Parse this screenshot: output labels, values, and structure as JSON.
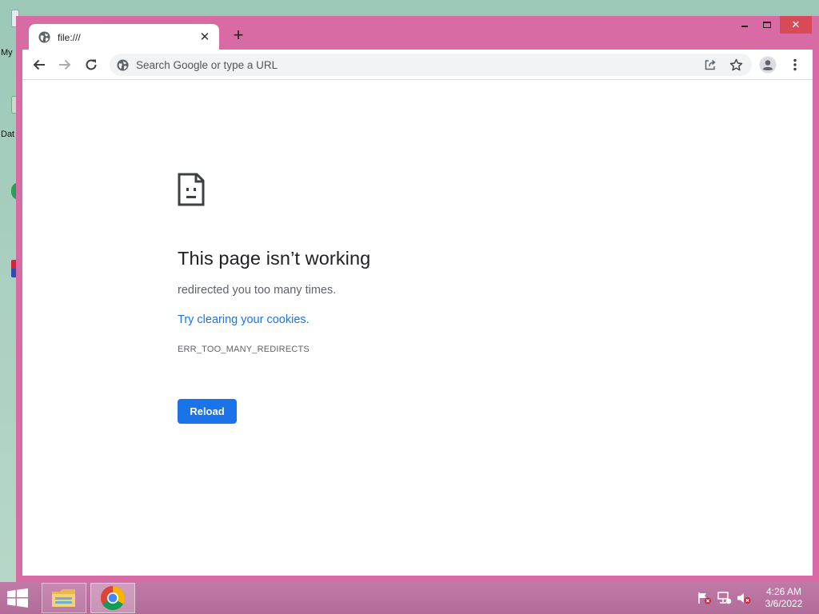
{
  "desktop": {
    "icons": [
      {
        "label": "My"
      },
      {
        "label": "Dat"
      }
    ]
  },
  "browser": {
    "tab": {
      "title": "file:///",
      "close_label": "✕",
      "new_tab_label": "+"
    },
    "window_controls": {
      "close_label": "✕"
    },
    "omnibox": {
      "placeholder": "Search Google or type a URL",
      "value": ""
    }
  },
  "page": {
    "title": "This page isn’t working",
    "description": "redirected you too many times.",
    "link": "Try clearing your cookies.",
    "error_code": "ERR_TOO_MANY_REDIRECTS",
    "reload_label": "Reload"
  },
  "taskbar": {
    "apps": [
      "file-explorer",
      "google-chrome"
    ],
    "clock": {
      "time": "4:26 AM",
      "date": "3/6/2022"
    }
  },
  "colors": {
    "window_frame": "#d86aa4",
    "taskbar": "#b26c9a",
    "accent_blue": "#1a73e8",
    "close_red": "#d84a58"
  }
}
